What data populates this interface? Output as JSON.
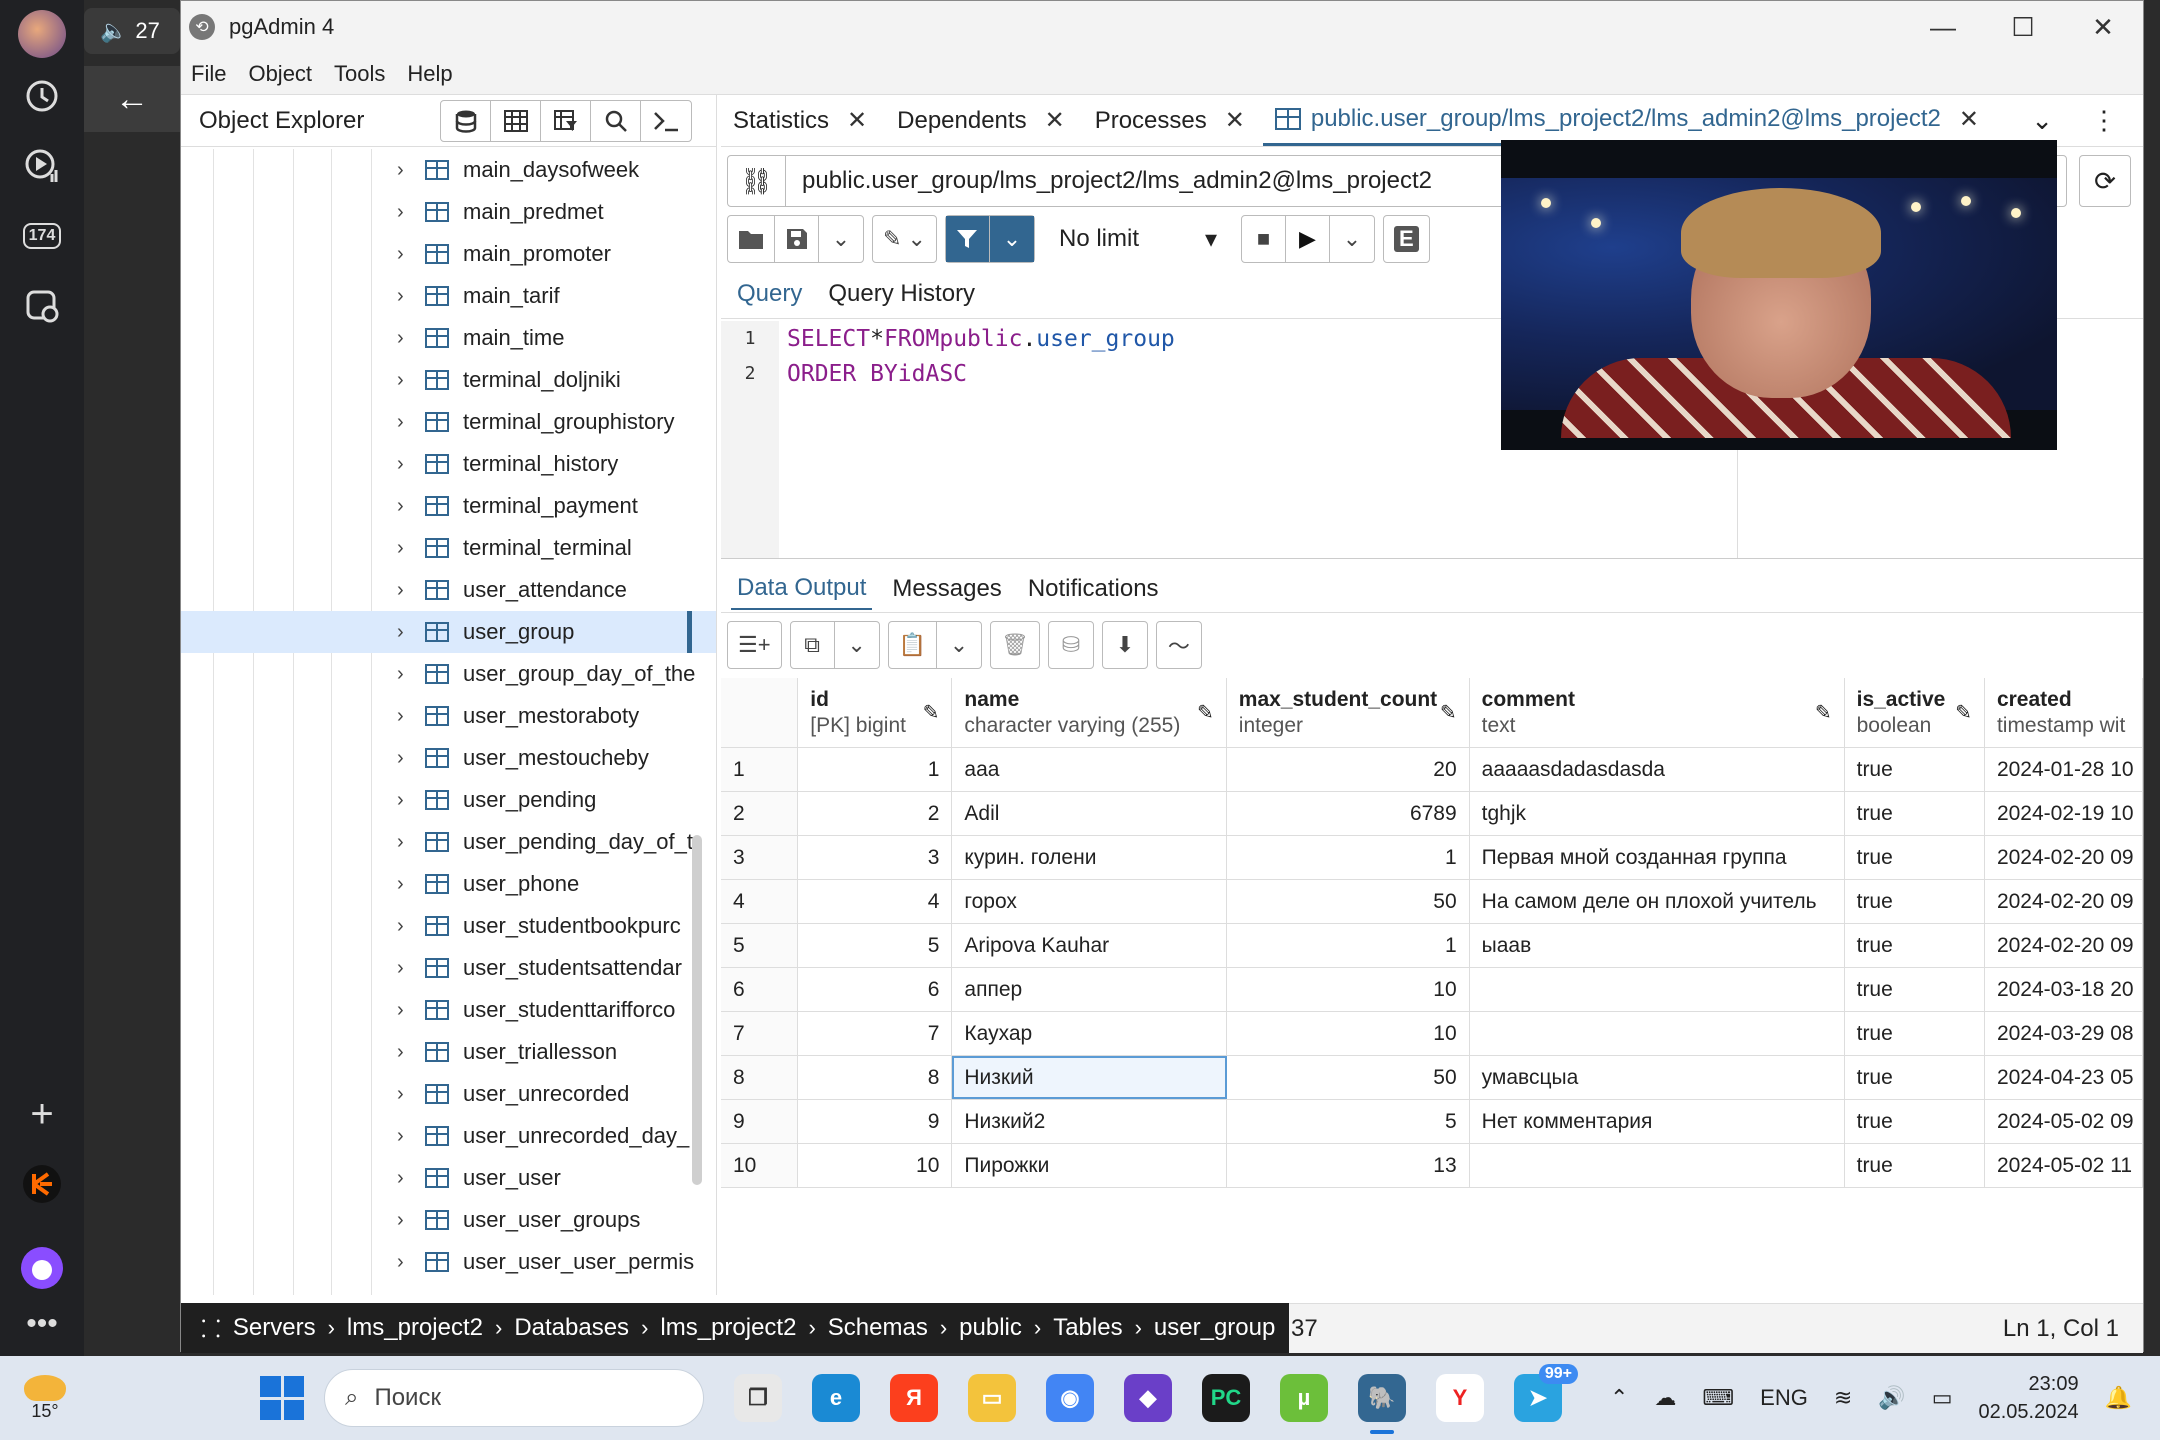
{
  "rail": {
    "badge": "174",
    "icons": [
      "avatar",
      "history-icon",
      "play-list-icon",
      "counter-badge",
      "camera-icon",
      "plus-icon",
      "kinopoisk-icon",
      "alice-icon",
      "more-icon"
    ]
  },
  "browser": {
    "audio_tab_label": "27"
  },
  "window": {
    "title": "pgAdmin 4",
    "menu": [
      "File",
      "Object",
      "Tools",
      "Help"
    ]
  },
  "explorer": {
    "title": "Object Explorer",
    "items": [
      "main_daysofweek",
      "main_predmet",
      "main_promoter",
      "main_tarif",
      "main_time",
      "terminal_doljniki",
      "terminal_grouphistory",
      "terminal_history",
      "terminal_payment",
      "terminal_terminal",
      "user_attendance",
      "user_group",
      "user_group_day_of_the",
      "user_mestoraboty",
      "user_mestoucheby",
      "user_pending",
      "user_pending_day_of_t",
      "user_phone",
      "user_studentbookpurc",
      "user_studentsattendar",
      "user_studenttarifforco",
      "user_triallesson",
      "user_unrecorded",
      "user_unrecorded_day_",
      "user_user",
      "user_user_groups",
      "user_user_user_permis"
    ],
    "selected_index": 11
  },
  "tabs": {
    "statistics": "Statistics",
    "dependents": "Dependents",
    "processes": "Processes",
    "query_tab": "public.user_group/lms_project2/lms_admin2@lms_project2"
  },
  "connection": "public.user_group/lms_project2/lms_admin2@lms_project2",
  "toolbar": {
    "limit": "No limit"
  },
  "query_tabs": {
    "query": "Query",
    "history": "Query History"
  },
  "editor": {
    "line_numbers": [
      "1",
      "2"
    ],
    "line1": {
      "select": "SELECT",
      "star": "*",
      "from": "FROM",
      "schema": "public",
      "dot": ".",
      "table": "user_group"
    },
    "line2": {
      "order": "ORDER BY",
      "col": "id",
      "dir": "ASC"
    }
  },
  "output_tabs": {
    "data": "Data Output",
    "messages": "Messages",
    "notifications": "Notifications"
  },
  "grid": {
    "columns": [
      {
        "name": "id",
        "type": "[PK] bigint"
      },
      {
        "name": "name",
        "type": "character varying (255)"
      },
      {
        "name": "max_student_count",
        "type": "integer"
      },
      {
        "name": "comment",
        "type": "text"
      },
      {
        "name": "is_active",
        "type": "boolean"
      },
      {
        "name": "created",
        "type": "timestamp wit"
      }
    ],
    "rows": [
      {
        "rn": "1",
        "id": "1",
        "name": "aaa",
        "max": "20",
        "comment": "aaaaasdadasdasda",
        "active": "true",
        "created": "2024-01-28 10"
      },
      {
        "rn": "2",
        "id": "2",
        "name": "Adil",
        "max": "6789",
        "comment": "tghjk",
        "active": "true",
        "created": "2024-02-19 10"
      },
      {
        "rn": "3",
        "id": "3",
        "name": "курин. голени",
        "max": "1",
        "comment": "Первая мной созданная группа",
        "active": "true",
        "created": "2024-02-20 09"
      },
      {
        "rn": "4",
        "id": "4",
        "name": "горох",
        "max": "50",
        "comment": "На самом деле он плохой учитель",
        "active": "true",
        "created": "2024-02-20 09"
      },
      {
        "rn": "5",
        "id": "5",
        "name": "Aripova Kauhar",
        "max": "1",
        "comment": "ыаав",
        "active": "true",
        "created": "2024-02-20 09"
      },
      {
        "rn": "6",
        "id": "6",
        "name": "аппер",
        "max": "10",
        "comment": "",
        "active": "true",
        "created": "2024-03-18 20"
      },
      {
        "rn": "7",
        "id": "7",
        "name": "Каухар",
        "max": "10",
        "comment": "",
        "active": "true",
        "created": "2024-03-29 08"
      },
      {
        "rn": "8",
        "id": "8",
        "name": "Низкий",
        "max": "50",
        "comment": "умавсцыа",
        "active": "true",
        "created": "2024-04-23 05"
      },
      {
        "rn": "9",
        "id": "9",
        "name": "Низкий2",
        "max": "5",
        "comment": "Нет комментария",
        "active": "true",
        "created": "2024-05-02 09"
      },
      {
        "rn": "10",
        "id": "10",
        "name": "Пирожки",
        "max": "13",
        "comment": "",
        "active": "true",
        "created": "2024-05-02 11"
      }
    ],
    "selected_row": 7
  },
  "breadcrumb": [
    "Servers",
    "lms_project2",
    "Databases",
    "lms_project2",
    "Schemas",
    "public",
    "Tables",
    "user_group"
  ],
  "status": {
    "partial": "37",
    "cursor": "Ln 1, Col 1"
  },
  "taskbar": {
    "weather_temp": "15°",
    "search_placeholder": "Поиск",
    "badge": "99+",
    "lang": "ENG",
    "time": "23:09",
    "date": "02.05.2024"
  }
}
